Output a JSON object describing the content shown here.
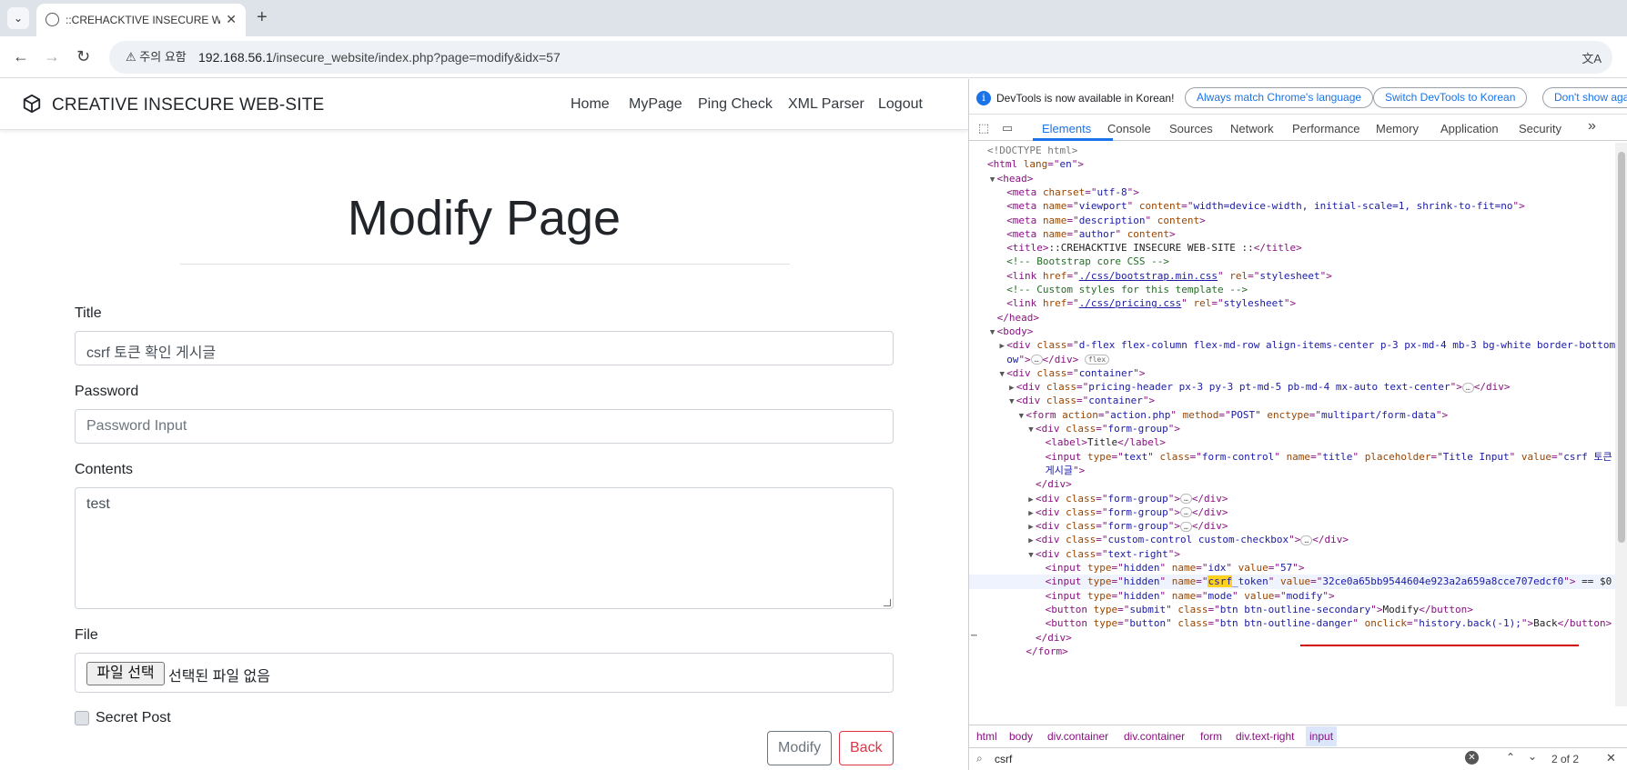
{
  "browser": {
    "tab_title": "::CREHACKTIVE INSECURE WEB-SITE ::",
    "security_label": "주의 요함",
    "url_host": "192.168.56.1",
    "url_path": "/insecure_website/index.php?page=modify&idx=57"
  },
  "site": {
    "brand": "CREATIVE INSECURE WEB-SITE",
    "nav": [
      "Home",
      "MyPage",
      "Ping Check",
      "XML Parser",
      "Logout"
    ],
    "heading": "Modify Page",
    "form": {
      "title_label": "Title",
      "title_value": "csrf 토큰 확인 게시글",
      "password_label": "Password",
      "password_placeholder": "Password Input",
      "contents_label": "Contents",
      "contents_value": "test",
      "file_label": "File",
      "file_button": "파일 선택",
      "file_status": "선택된 파일 없음",
      "secret_label": "Secret Post",
      "modify_button": "Modify",
      "back_button": "Back"
    }
  },
  "devtools": {
    "notice_text": "DevTools is now available in Korean!",
    "notice_buttons": [
      "Always match Chrome's language",
      "Switch DevTools to Korean",
      "Don't show aga"
    ],
    "tabs": [
      "Elements",
      "Console",
      "Sources",
      "Network",
      "Performance",
      "Memory",
      "Application",
      "Security"
    ],
    "active_tab": "Elements",
    "more_tabs": "»",
    "dom_lines": [
      {
        "i": 0,
        "a": "",
        "h": "<span class=\"doctype\">&lt;!DOCTYPE html&gt;</span>"
      },
      {
        "i": 0,
        "a": "",
        "h": "<span class=\"tag\">&lt;html </span><span class=\"attr\">lang</span><span class=\"tag\">=\"</span><span class=\"val\">en</span><span class=\"tag\">\"&gt;</span>"
      },
      {
        "i": 1,
        "a": "▼",
        "h": "<span class=\"tag\">&lt;head&gt;</span>"
      },
      {
        "i": 2,
        "a": "",
        "h": "<span class=\"tag\">&lt;meta </span><span class=\"attr\">charset</span><span class=\"tag\">=\"</span><span class=\"val\">utf-8</span><span class=\"tag\">\"&gt;</span>"
      },
      {
        "i": 2,
        "a": "",
        "h": "<span class=\"tag\">&lt;meta </span><span class=\"attr\">name</span><span class=\"tag\">=\"</span><span class=\"val\">viewport</span><span class=\"tag\">\" </span><span class=\"attr\">content</span><span class=\"tag\">=\"</span><span class=\"val\">width=device-width, initial-scale=1, shrink-to-fit=no</span><span class=\"tag\">\"&gt;</span>"
      },
      {
        "i": 2,
        "a": "",
        "h": "<span class=\"tag\">&lt;meta </span><span class=\"attr\">name</span><span class=\"tag\">=\"</span><span class=\"val\">description</span><span class=\"tag\">\" </span><span class=\"attr\">content</span><span class=\"tag\">&gt;</span>"
      },
      {
        "i": 2,
        "a": "",
        "h": "<span class=\"tag\">&lt;meta </span><span class=\"attr\">name</span><span class=\"tag\">=\"</span><span class=\"val\">author</span><span class=\"tag\">\" </span><span class=\"attr\">content</span><span class=\"tag\">&gt;</span>"
      },
      {
        "i": 2,
        "a": "",
        "h": "<span class=\"tag\">&lt;title&gt;</span><span class=\"txt\">::CREHACKTIVE INSECURE WEB-SITE ::</span><span class=\"tag\">&lt;/title&gt;</span>"
      },
      {
        "i": 2,
        "a": "",
        "h": "<span class=\"cm\">&lt;!-- Bootstrap core CSS --&gt;</span>"
      },
      {
        "i": 2,
        "a": "",
        "h": "<span class=\"tag\">&lt;link </span><span class=\"attr\">href</span><span class=\"tag\">=\"</span><span class=\"link\">./css/bootstrap.min.css</span><span class=\"tag\">\" </span><span class=\"attr\">rel</span><span class=\"tag\">=\"</span><span class=\"val\">stylesheet</span><span class=\"tag\">\"&gt;</span>"
      },
      {
        "i": 2,
        "a": "",
        "h": "<span class=\"cm\">&lt;!-- Custom styles for this template --&gt;</span>"
      },
      {
        "i": 2,
        "a": "",
        "h": "<span class=\"tag\">&lt;link </span><span class=\"attr\">href</span><span class=\"tag\">=\"</span><span class=\"link\">./css/pricing.css</span><span class=\"tag\">\" </span><span class=\"attr\">rel</span><span class=\"tag\">=\"</span><span class=\"val\">stylesheet</span><span class=\"tag\">\"&gt;</span>"
      },
      {
        "i": 1,
        "a": "",
        "h": "<span class=\"tag\">&lt;/head&gt;</span>"
      },
      {
        "i": 1,
        "a": "▼",
        "h": "<span class=\"tag\">&lt;body&gt;</span>"
      },
      {
        "i": 2,
        "a": "▶",
        "h": "<span class=\"tag\">&lt;div </span><span class=\"attr\">class</span><span class=\"tag\">=\"</span><span class=\"val\">d-flex flex-column flex-md-row align-items-center p-3 px-md-4 mb-3 bg-white border-bottom box-shad</span>"
      },
      {
        "i": 2,
        "a": "",
        "h": "<span class=\"val\">ow</span><span class=\"tag\">\"&gt;</span><span class=\"pill\">…</span><span class=\"tag\">&lt;/div&gt;</span> <span class=\"pill\">flex</span>"
      },
      {
        "i": 2,
        "a": "▼",
        "h": "<span class=\"tag\">&lt;div </span><span class=\"attr\">class</span><span class=\"tag\">=\"</span><span class=\"val\">container</span><span class=\"tag\">\"&gt;</span>"
      },
      {
        "i": 3,
        "a": "▶",
        "h": "<span class=\"tag\">&lt;div </span><span class=\"attr\">class</span><span class=\"tag\">=\"</span><span class=\"val\">pricing-header px-3 py-3 pt-md-5 pb-md-4 mx-auto text-center</span><span class=\"tag\">\"&gt;</span><span class=\"pill\">…</span><span class=\"tag\">&lt;/div&gt;</span>"
      },
      {
        "i": 3,
        "a": "▼",
        "h": "<span class=\"tag\">&lt;div </span><span class=\"attr\">class</span><span class=\"tag\">=\"</span><span class=\"val\">container</span><span class=\"tag\">\"&gt;</span>"
      },
      {
        "i": 4,
        "a": "▼",
        "h": "<span class=\"tag\">&lt;form </span><span class=\"attr\">action</span><span class=\"tag\">=\"</span><span class=\"val\">action.php</span><span class=\"tag\">\" </span><span class=\"attr\">method</span><span class=\"tag\">=\"</span><span class=\"val\">POST</span><span class=\"tag\">\" </span><span class=\"attr\">enctype</span><span class=\"tag\">=\"</span><span class=\"val\">multipart/form-data</span><span class=\"tag\">\"&gt;</span>"
      },
      {
        "i": 5,
        "a": "▼",
        "h": "<span class=\"tag\">&lt;div </span><span class=\"attr\">class</span><span class=\"tag\">=\"</span><span class=\"val\">form-group</span><span class=\"tag\">\"&gt;</span>"
      },
      {
        "i": 6,
        "a": "",
        "h": "<span class=\"tag\">&lt;label&gt;</span><span class=\"txt\">Title</span><span class=\"tag\">&lt;/label&gt;</span>"
      },
      {
        "i": 6,
        "a": "",
        "h": "<span class=\"tag\">&lt;input </span><span class=\"attr\">type</span><span class=\"tag\">=\"</span><span class=\"val\">text</span><span class=\"tag\">\" </span><span class=\"attr\">class</span><span class=\"tag\">=\"</span><span class=\"val\">form-control</span><span class=\"tag\">\" </span><span class=\"attr\">name</span><span class=\"tag\">=\"</span><span class=\"val\">title</span><span class=\"tag\">\" </span><span class=\"attr\">placeholder</span><span class=\"tag\">=\"</span><span class=\"val\">Title Input</span><span class=\"tag\">\" </span><span class=\"attr\">value</span><span class=\"tag\">=\"</span><span class=\"val\">csrf 토큰 확인</span>"
      },
      {
        "i": 6,
        "a": "",
        "h": "<span class=\"val\">게시글</span><span class=\"tag\">\"&gt;</span>"
      },
      {
        "i": 5,
        "a": "",
        "h": "<span class=\"tag\">&lt;/div&gt;</span>"
      },
      {
        "i": 5,
        "a": "▶",
        "h": "<span class=\"tag\">&lt;div </span><span class=\"attr\">class</span><span class=\"tag\">=\"</span><span class=\"val\">form-group</span><span class=\"tag\">\"&gt;</span><span class=\"pill\">…</span><span class=\"tag\">&lt;/div&gt;</span>"
      },
      {
        "i": 5,
        "a": "▶",
        "h": "<span class=\"tag\">&lt;div </span><span class=\"attr\">class</span><span class=\"tag\">=\"</span><span class=\"val\">form-group</span><span class=\"tag\">\"&gt;</span><span class=\"pill\">…</span><span class=\"tag\">&lt;/div&gt;</span>"
      },
      {
        "i": 5,
        "a": "▶",
        "h": "<span class=\"tag\">&lt;div </span><span class=\"attr\">class</span><span class=\"tag\">=\"</span><span class=\"val\">form-group</span><span class=\"tag\">\"&gt;</span><span class=\"pill\">…</span><span class=\"tag\">&lt;/div&gt;</span>"
      },
      {
        "i": 5,
        "a": "▶",
        "h": "<span class=\"tag\">&lt;div </span><span class=\"attr\">class</span><span class=\"tag\">=\"</span><span class=\"val\">custom-control custom-checkbox</span><span class=\"tag\">\"&gt;</span><span class=\"pill\">…</span><span class=\"tag\">&lt;/div&gt;</span>"
      },
      {
        "i": 5,
        "a": "▼",
        "h": "<span class=\"tag\">&lt;div </span><span class=\"attr\">class</span><span class=\"tag\">=\"</span><span class=\"val\">text-right</span><span class=\"tag\">\"&gt;</span>"
      },
      {
        "i": 6,
        "a": "",
        "h": "<span class=\"tag\">&lt;input </span><span class=\"attr\">type</span><span class=\"tag\">=\"</span><span class=\"val\">hidden</span><span class=\"tag\">\" </span><span class=\"attr\">name</span><span class=\"tag\">=\"</span><span class=\"val\">idx</span><span class=\"tag\">\" </span><span class=\"attr\">value</span><span class=\"tag\">=\"</span><span class=\"val\">57</span><span class=\"tag\">\"&gt;</span>"
      },
      {
        "i": 6,
        "a": "",
        "sel": true,
        "h": "<span class=\"tag\">&lt;input </span><span class=\"attr\">type</span><span class=\"tag\">=\"</span><span class=\"val\">hidden</span><span class=\"tag\">\" </span><span class=\"attr\">name</span><span class=\"tag\">=\"</span><span class=\"val\"><span class=\"hl\">csrf</span>_token</span><span class=\"tag\">\" </span><span class=\"attr\">value</span><span class=\"tag\">=\"</span><span class=\"val\">32ce0a65bb9544604e923a2a659a8cce707edcf0</span><span class=\"tag\">\"&gt;</span> <span class=\"txt\">== $0</span>"
      },
      {
        "i": 6,
        "a": "",
        "h": "<span class=\"tag\">&lt;input </span><span class=\"attr\">type</span><span class=\"tag\">=\"</span><span class=\"val\">hidden</span><span class=\"tag\">\" </span><span class=\"attr\">name</span><span class=\"tag\">=\"</span><span class=\"val\">mode</span><span class=\"tag\">\" </span><span class=\"attr\">value</span><span class=\"tag\">=\"</span><span class=\"val\">modify</span><span class=\"tag\">\"&gt;</span>"
      },
      {
        "i": 6,
        "a": "",
        "h": "<span class=\"tag\">&lt;button </span><span class=\"attr\">type</span><span class=\"tag\">=\"</span><span class=\"val\">submit</span><span class=\"tag\">\" </span><span class=\"attr\">class</span><span class=\"tag\">=\"</span><span class=\"val\">btn btn-outline-secondary</span><span class=\"tag\">\"&gt;</span><span class=\"txt\">Modify</span><span class=\"tag\">&lt;/button&gt;</span>"
      },
      {
        "i": 6,
        "a": "",
        "h": "<span class=\"tag\">&lt;button </span><span class=\"attr\">type</span><span class=\"tag\">=\"</span><span class=\"val\">button</span><span class=\"tag\">\" </span><span class=\"attr\">class</span><span class=\"tag\">=\"</span><span class=\"val\">btn btn-outline-danger</span><span class=\"tag\">\" </span><span class=\"attr\">onclick</span><span class=\"tag\">=\"</span><span class=\"val\">history.back(-1);</span><span class=\"tag\">\"&gt;</span><span class=\"txt\">Back</span><span class=\"tag\">&lt;/button&gt;</span>"
      },
      {
        "i": 5,
        "a": "",
        "h": "<span class=\"tag\">&lt;/div&gt;</span>"
      },
      {
        "i": 4,
        "a": "",
        "h": "<span class=\"tag\">&lt;/form&gt;</span>"
      }
    ],
    "breadcrumbs": [
      "html",
      "body",
      "div.container",
      "div.container",
      "form",
      "div.text-right",
      "input"
    ],
    "search_value": "csrf",
    "search_count": "2 of 2"
  },
  "colors": {
    "devtools_accent": "#1a73e8",
    "search_highlight": "#ffd21f",
    "annotation_red": "#d10000",
    "btn_secondary": "#6c757d",
    "btn_danger": "#dc3545"
  }
}
